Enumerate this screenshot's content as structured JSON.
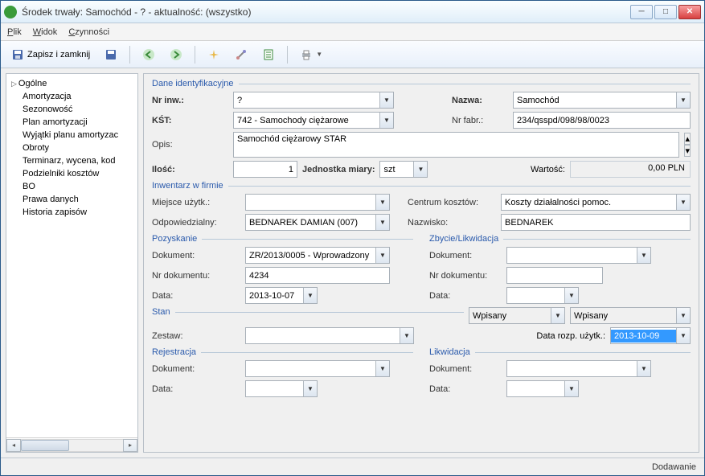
{
  "window": {
    "title": "Środek trwały: Samochód - ? - aktualność: (wszystko)"
  },
  "menu": {
    "plik": "Plik",
    "widok": "Widok",
    "czynnosci": "Czynności"
  },
  "toolbar": {
    "save_close": "Zapisz i zamknij"
  },
  "sidebar": {
    "items": [
      "Ogólne",
      "Amortyzacja",
      "Sezonowość",
      "Plan amortyzacji",
      "Wyjątki planu amortyzac",
      "Obroty",
      "Terminarz, wycena, kod",
      "Podzielniki kosztów",
      "BO",
      "Prawa danych",
      "Historia zapisów"
    ]
  },
  "sections": {
    "ident": "Dane identyfikacyjne",
    "inwentarz": "Inwentarz w firmie",
    "pozyskanie": "Pozyskanie",
    "zbycie": "Zbycie/Likwidacja",
    "stan": "Stan",
    "rejestracja": "Rejestracja",
    "likwidacja": "Likwidacja"
  },
  "labels": {
    "nr_inw": "Nr inw.:",
    "nazwa": "Nazwa:",
    "kst": "KŚT:",
    "nr_fabr": "Nr fabr.:",
    "opis": "Opis:",
    "ilosc": "Ilość:",
    "jedn": "Jednostka miary:",
    "wartosc": "Wartość:",
    "miejsce": "Miejsce użytk.:",
    "centrum": "Centrum kosztów:",
    "odpow": "Odpowiedzialny:",
    "nazwisko": "Nazwisko:",
    "dokument": "Dokument:",
    "nr_dok": "Nr dokumentu:",
    "data": "Data:",
    "zestaw": "Zestaw:",
    "data_rozp": "Data rozp. użytk.:"
  },
  "values": {
    "nr_inw": "?",
    "nazwa": "Samochód",
    "kst": "742 - Samochody ciężarowe",
    "nr_fabr": "234/qsspd/098/98/0023",
    "opis": "Samochód ciężarowy STAR",
    "ilosc": "1",
    "jedn": "szt",
    "wartosc": "0,00 PLN",
    "miejsce": "",
    "centrum": "Koszty działalności pomoc.",
    "odpow": "BEDNAREK DAMIAN (007)",
    "nazwisko": "BEDNAREK",
    "poz_dokument": "ZR/2013/0005 - Wprowadzony",
    "poz_nr": "4234",
    "poz_data": "2013-10-07",
    "zby_dokument": "",
    "zby_nr": "",
    "zby_data": "",
    "stan1": "Wpisany",
    "stan2": "Wpisany",
    "zestaw": "",
    "data_rozp": "2013-10-09",
    "rej_dokument": "",
    "rej_data": "",
    "lik_dokument": "",
    "lik_data": ""
  },
  "status": "Dodawanie"
}
